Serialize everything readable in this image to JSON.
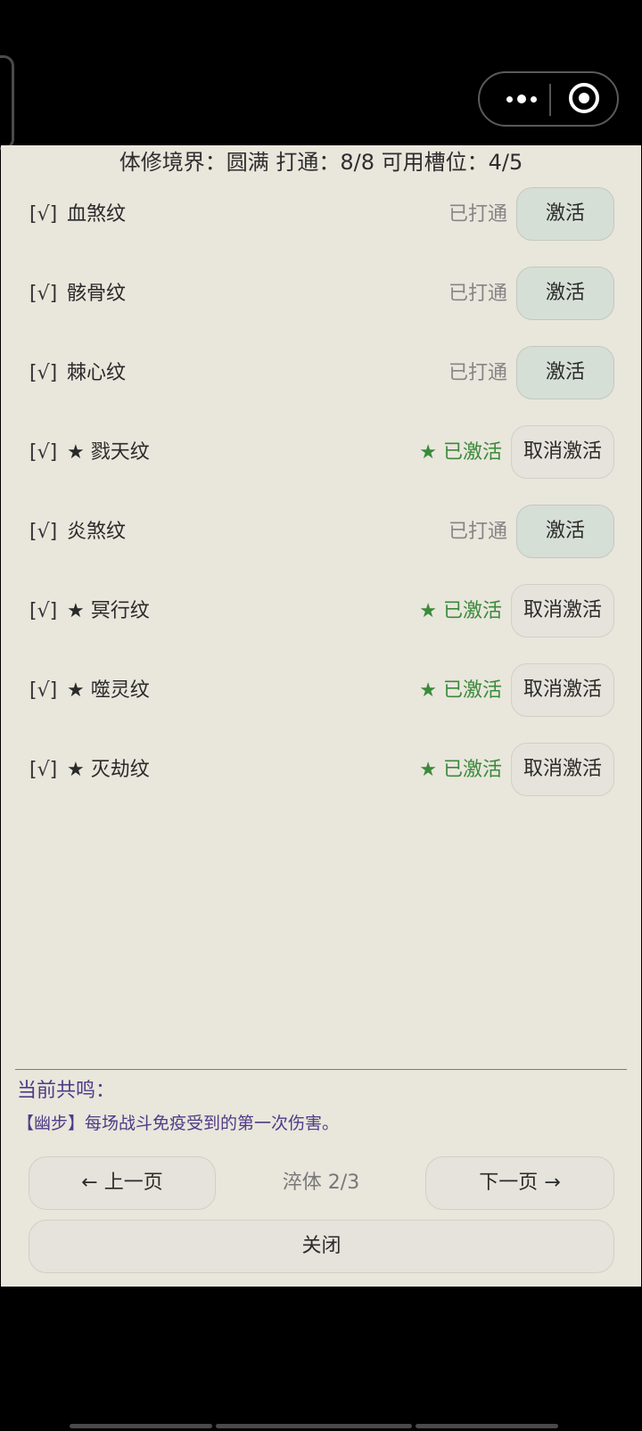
{
  "header": {
    "realm_label": "体修境界：",
    "realm_value": "圆满",
    "open_label": "打通：",
    "open_value": "8/8",
    "slot_label": "可用槽位：",
    "slot_value": "4/5"
  },
  "patterns": [
    {
      "check": "[√]",
      "star": "",
      "name": "血煞纹",
      "status": "已打通",
      "status_type": "opened",
      "action": "激活"
    },
    {
      "check": "[√]",
      "star": "",
      "name": "骸骨纹",
      "status": "已打通",
      "status_type": "opened",
      "action": "激活"
    },
    {
      "check": "[√]",
      "star": "",
      "name": "棘心纹",
      "status": "已打通",
      "status_type": "opened",
      "action": "激活"
    },
    {
      "check": "[√]",
      "star": "★ ",
      "name": "戮天纹",
      "status": "★ 已激活",
      "status_type": "active",
      "action": "取消激活"
    },
    {
      "check": "[√]",
      "star": "",
      "name": "炎煞纹",
      "status": "已打通",
      "status_type": "opened",
      "action": "激活"
    },
    {
      "check": "[√]",
      "star": "★ ",
      "name": "冥行纹",
      "status": "★ 已激活",
      "status_type": "active",
      "action": "取消激活"
    },
    {
      "check": "[√]",
      "star": "★ ",
      "name": "噬灵纹",
      "status": "★ 已激活",
      "status_type": "active",
      "action": "取消激活"
    },
    {
      "check": "[√]",
      "star": "★ ",
      "name": "灭劫纹",
      "status": "★ 已激活",
      "status_type": "active",
      "action": "取消激活"
    }
  ],
  "resonance": {
    "label": "当前共鸣：",
    "desc": "【幽步】每场战斗免疫受到的第一次伤害。"
  },
  "pager": {
    "prev": "← 上一页",
    "indicator": "淬体 2/3",
    "next": "下一页 →"
  },
  "close_label": "关闭",
  "colors": {
    "panel_bg": "#e9e6dc",
    "active_green": "#3a8a3a",
    "resonance_purple": "#4f3b86",
    "activate_btn_bg": "#d6dfd6"
  }
}
